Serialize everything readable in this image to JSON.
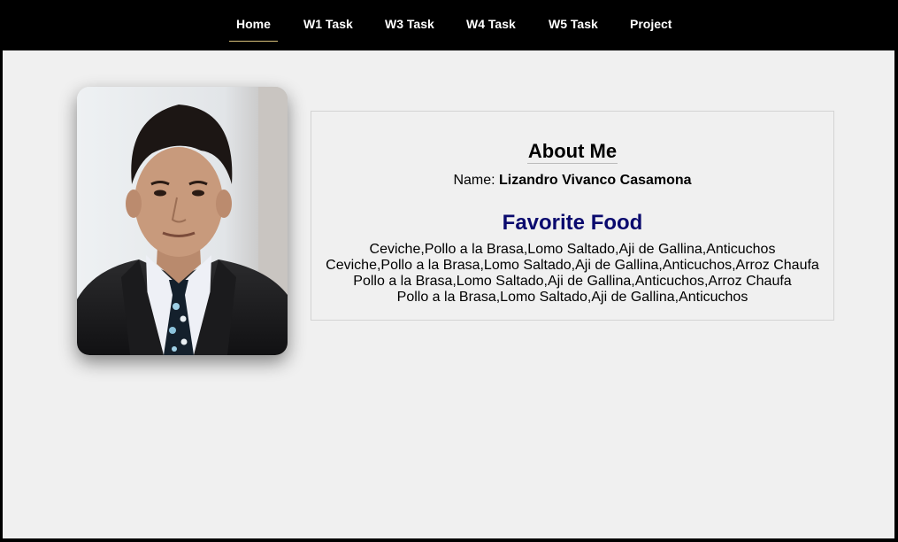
{
  "nav": {
    "items": [
      {
        "label": "Home",
        "active": true
      },
      {
        "label": "W1 Task"
      },
      {
        "label": "W3 Task"
      },
      {
        "label": "W4 Task"
      },
      {
        "label": "W5 Task"
      },
      {
        "label": "Project"
      }
    ]
  },
  "about": {
    "title": "About Me",
    "name_label": "Name:",
    "name_value": "Lizandro Vivanco Casamona"
  },
  "food": {
    "title": "Favorite Food",
    "lines": [
      "Ceviche,Pollo a la Brasa,Lomo Saltado,Aji de Gallina,Anticuchos",
      "Ceviche,Pollo a la Brasa,Lomo Saltado,Aji de Gallina,Anticuchos,Arroz Chaufa",
      "Pollo a la Brasa,Lomo Saltado,Aji de Gallina,Anticuchos,Arroz Chaufa",
      "Pollo a la Brasa,Lomo Saltado,Aji de Gallina,Anticuchos"
    ]
  },
  "colors": {
    "navbar_bg": "#000000",
    "page_bg": "#f0f0f0",
    "food_title": "#0a0a6e",
    "active_underline": "#d8c07a"
  }
}
